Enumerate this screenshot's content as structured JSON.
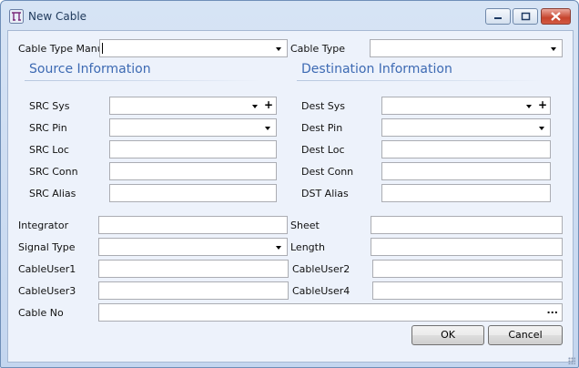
{
  "window": {
    "title": "New Cable",
    "controls": {
      "minimize": "minimize",
      "maximize": "maximize",
      "close": "close"
    }
  },
  "top": {
    "cable_type_manu": {
      "label": "Cable Type Manu",
      "value": ""
    },
    "cable_type": {
      "label": "Cable Type",
      "value": ""
    }
  },
  "source": {
    "heading": "Source Information",
    "sys": {
      "label": "SRC Sys",
      "value": ""
    },
    "pin": {
      "label": "SRC Pin",
      "value": ""
    },
    "loc": {
      "label": "SRC Loc",
      "value": ""
    },
    "conn": {
      "label": "SRC Conn",
      "value": ""
    },
    "alias": {
      "label": "SRC Alias",
      "value": ""
    }
  },
  "destination": {
    "heading": "Destination Information",
    "sys": {
      "label": "Dest Sys",
      "value": ""
    },
    "pin": {
      "label": "Dest Pin",
      "value": ""
    },
    "loc": {
      "label": "Dest Loc",
      "value": ""
    },
    "conn": {
      "label": "Dest Conn",
      "value": ""
    },
    "alias": {
      "label": "DST Alias",
      "value": ""
    }
  },
  "details": {
    "integrator": {
      "label": "Integrator",
      "value": ""
    },
    "sheet": {
      "label": "Sheet",
      "value": ""
    },
    "signal_type": {
      "label": "Signal Type",
      "value": ""
    },
    "length": {
      "label": "Length",
      "value": ""
    },
    "cableuser1": {
      "label": "CableUser1",
      "value": ""
    },
    "cableuser2": {
      "label": "CableUser2",
      "value": ""
    },
    "cableuser3": {
      "label": "CableUser3",
      "value": ""
    },
    "cableuser4": {
      "label": "CableUser4",
      "value": ""
    },
    "cable_no": {
      "label": "Cable No",
      "value": "",
      "browse": "..."
    }
  },
  "buttons": {
    "ok": "OK",
    "cancel": "Cancel"
  },
  "icons": {
    "app": "cable-app-icon",
    "dropdown": "chevron-down-icon",
    "add": "plus-icon",
    "browse": "ellipsis-icon",
    "resize": "resize-grip-icon"
  },
  "colors": {
    "section_heading": "#3d6ab3",
    "client_bg": "#edf2fb",
    "close_button": "#c6442d"
  }
}
